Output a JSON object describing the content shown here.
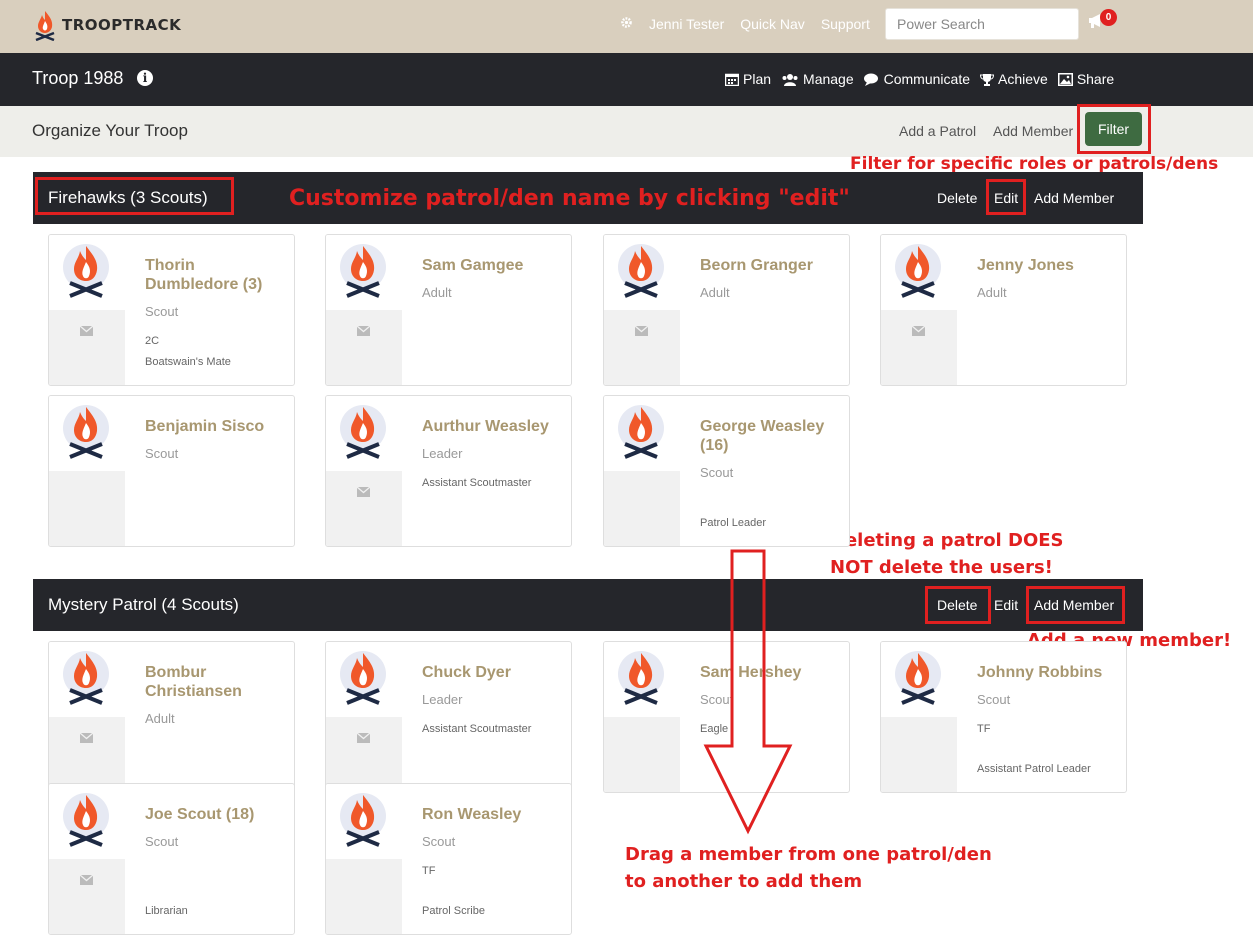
{
  "brand": {
    "name": "TROOPTRACK",
    "logo_icon": "campfire-icon"
  },
  "topnav": {
    "user": "Jenni Tester",
    "quick_nav": "Quick Nav",
    "support": "Support",
    "search_placeholder": "Power Search",
    "notifications": "0"
  },
  "navbar": {
    "troop": "Troop 1988",
    "links": [
      "Plan",
      "Manage",
      "Communicate",
      "Achieve",
      "Share"
    ]
  },
  "subbar": {
    "title": "Organize Your Troop",
    "add_patrol": "Add a Patrol",
    "add_member": "Add Member",
    "filter": "Filter"
  },
  "annotations": {
    "filter": "Filter for specific roles or patrols/dens",
    "edit": "Customize patrol/den name by clicking \"edit\"",
    "delete_line1": "Deleting a patrol DOES",
    "delete_line2": "NOT delete the users!",
    "add_member": "Add a new member!",
    "drag_line1": "Drag a member from one patrol/den",
    "drag_line2": "to another to add them"
  },
  "colors": {
    "topbar": "#d9cfbe",
    "navbar": "#25262b",
    "accent_green": "#3e6b41",
    "annotation_red": "#e02020",
    "member_name": "#a89770"
  },
  "patrols": [
    {
      "name": "Firehawks (3 Scouts)",
      "delete": "Delete",
      "edit": "Edit",
      "add_member": "Add Member",
      "members": [
        {
          "name": "Thorin Dumbledore (3)",
          "role": "Scout",
          "extra1": "2C",
          "extra2": "Boatswain's Mate"
        },
        {
          "name": "Sam Gamgee",
          "role": "Adult",
          "extra1": "",
          "extra2": ""
        },
        {
          "name": "Beorn Granger",
          "role": "Adult",
          "extra1": "",
          "extra2": ""
        },
        {
          "name": "Jenny Jones",
          "role": "Adult",
          "extra1": "",
          "extra2": ""
        },
        {
          "name": "Benjamin Sisco",
          "role": "Scout",
          "extra1": "",
          "extra2": ""
        },
        {
          "name": "Aurthur Weasley",
          "role": "Leader",
          "extra1": "Assistant Scoutmaster",
          "extra2": ""
        },
        {
          "name": "George Weasley (16)",
          "role": "Scout",
          "extra1": "",
          "extra2": "Patrol Leader"
        }
      ]
    },
    {
      "name": "Mystery Patrol (4 Scouts)",
      "delete": "Delete",
      "edit": "Edit",
      "add_member": "Add Member",
      "members": [
        {
          "name": "Bombur Christiansen",
          "role": "Adult",
          "extra1": "",
          "extra2": ""
        },
        {
          "name": "Chuck Dyer",
          "role": "Leader",
          "extra1": "Assistant Scoutmaster",
          "extra2": ""
        },
        {
          "name": "Sam Hershey",
          "role": "Scout",
          "extra1": "Eagle",
          "extra2": ""
        },
        {
          "name": "Johnny Robbins",
          "role": "Scout",
          "extra1": "TF",
          "extra2": "Assistant Patrol Leader"
        },
        {
          "name": "Joe Scout (18)",
          "role": "Scout",
          "extra1": "",
          "extra2": "Librarian"
        },
        {
          "name": "Ron Weasley",
          "role": "Scout",
          "extra1": "TF",
          "extra2": "Patrol Scribe"
        }
      ]
    }
  ]
}
